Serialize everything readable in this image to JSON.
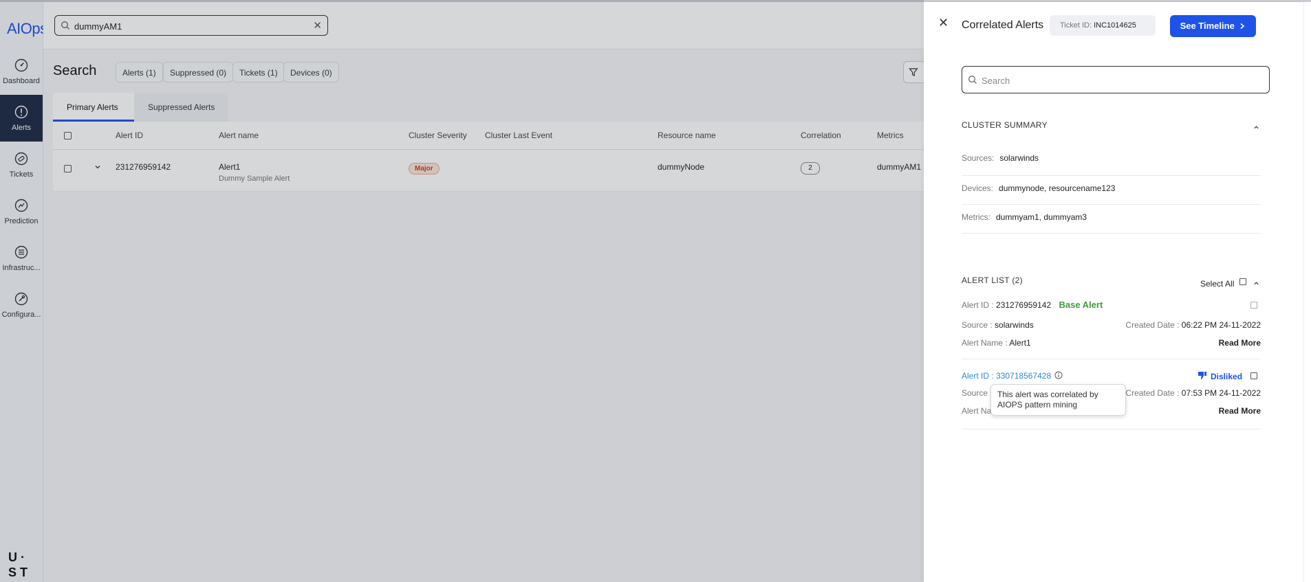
{
  "app": {
    "logo": "AIOps",
    "brand_mark": "U S T"
  },
  "colors": {
    "accent": "#1f53e8",
    "nav_active_bg": "#1e2a44",
    "base_alert": "#3a9d3a",
    "severity_major": "#c0461b"
  },
  "nav": [
    {
      "label": "Dashboard",
      "icon": "dashboard-gauge-icon"
    },
    {
      "label": "Alerts",
      "icon": "alert-circle-icon",
      "active": true
    },
    {
      "label": "Tickets",
      "icon": "ticket-icon"
    },
    {
      "label": "Prediction",
      "icon": "prediction-icon"
    },
    {
      "label": "Infrastruc...",
      "icon": "infrastructure-list-icon"
    },
    {
      "label": "Configura...",
      "icon": "configuration-icon"
    }
  ],
  "header": {
    "search_value": "dummyAM1"
  },
  "search_page": {
    "title": "Search",
    "chips": [
      "Alerts (1)",
      "Suppressed (0)",
      "Tickets (1)",
      "Devices (0)"
    ],
    "tabs": [
      "Primary Alerts",
      "Suppressed Alerts"
    ],
    "columns": [
      "Alert ID",
      "Alert name",
      "Cluster Severity",
      "Cluster Last Event",
      "Resource name",
      "Correlation",
      "Metrics"
    ],
    "rows": [
      {
        "alert_id": "231276959142",
        "alert_name": "Alert1",
        "alert_desc": "Dummy Sample Alert",
        "severity": "Major",
        "last_event": "",
        "resource": "dummyNode",
        "correlation": "2",
        "metrics": "dummyAM1"
      }
    ]
  },
  "panel": {
    "title": "Correlated Alerts",
    "ticket_label": "Ticket ID:",
    "ticket_id": "INC1014625",
    "timeline_button": "See Timeline",
    "search_placeholder": "Search",
    "cluster_summary": {
      "heading": "CLUSTER SUMMARY",
      "rows": [
        {
          "label": "Sources:",
          "value": "solarwinds"
        },
        {
          "label": "Devices:",
          "value": "dummynode, resourcename123"
        },
        {
          "label": "Metrics:",
          "value": "dummyam1, dummyam3"
        }
      ]
    },
    "alert_list": {
      "heading": "ALERT LIST (2)",
      "select_all": "Select All",
      "alerts": [
        {
          "id_label": "Alert ID :",
          "id": "231276959142",
          "tag": "Base Alert",
          "source_label": "Source :",
          "source": "solarwinds",
          "created_label": "Created Date :",
          "created": "06:22 PM 24-11-2022",
          "name_label": "Alert Name :",
          "name": "Alert1",
          "read_more": "Read More"
        },
        {
          "id_label": "Alert ID :",
          "id": "330718567428",
          "feedback": "Disliked",
          "source_label": "Source",
          "source": "",
          "created_label": "Created Date :",
          "created": "07:53 PM 24-11-2022",
          "name_label": "Alert Na",
          "name": "",
          "read_more": "Read More"
        }
      ]
    },
    "tooltip": "This alert was correlated by AIOPS pattern mining"
  }
}
